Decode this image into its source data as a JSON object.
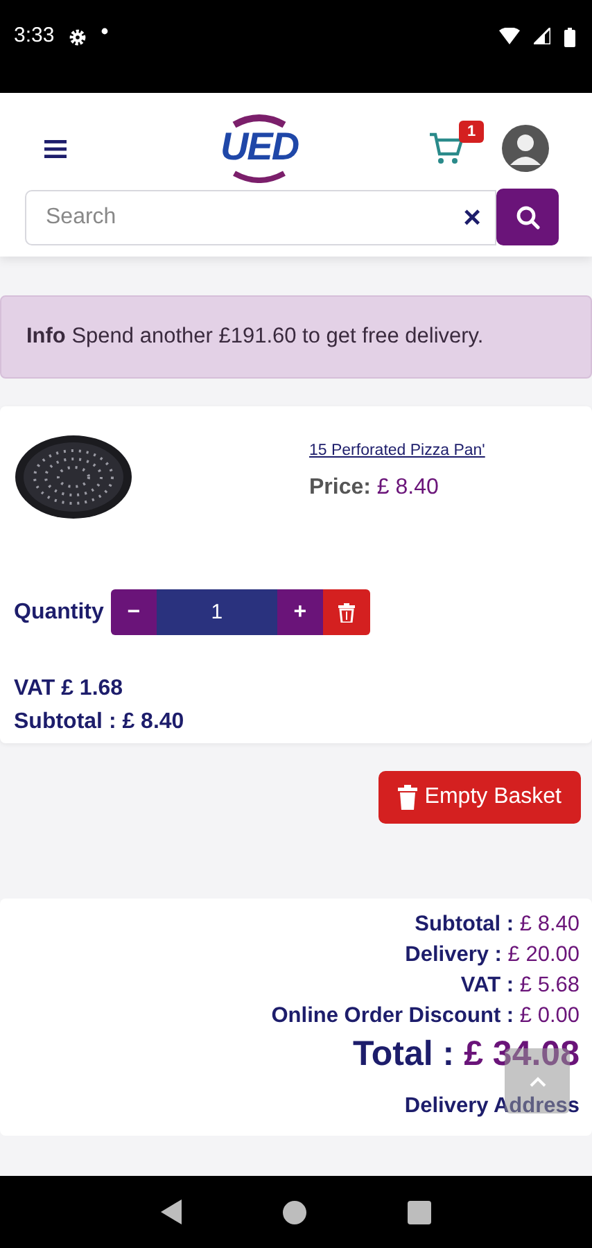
{
  "status_bar": {
    "time": "3:33"
  },
  "header": {
    "logo_text": "UED",
    "cart_count": "1"
  },
  "search": {
    "placeholder": "Search",
    "clear": "×"
  },
  "alert": {
    "title": "Info",
    "message": "Spend another £191.60 to get free delivery."
  },
  "items": [
    {
      "name": "15 Perforated Pizza Pan'",
      "price_label": "Price:",
      "price": "£ 8.40",
      "quantity_label": "Quantity",
      "minus": "−",
      "quantity": "1",
      "plus": "+",
      "vat": "VAT £ 1.68",
      "subtotal": "Subtotal : £ 8.40"
    }
  ],
  "empty_basket": "Empty Basket",
  "totals": [
    {
      "label": "Subtotal :",
      "value": "£ 8.40",
      "kind": "line"
    },
    {
      "label": "Delivery :",
      "value": "£ 20.00",
      "kind": "line"
    },
    {
      "label": "VAT :",
      "value": "£ 5.68",
      "kind": "line"
    },
    {
      "label": "Online Order Discount :",
      "value": "£ 0.00",
      "kind": "line"
    },
    {
      "label": "Total :",
      "value": "£ 34.08",
      "kind": "total"
    }
  ],
  "delivery_address": "Delivery Address"
}
